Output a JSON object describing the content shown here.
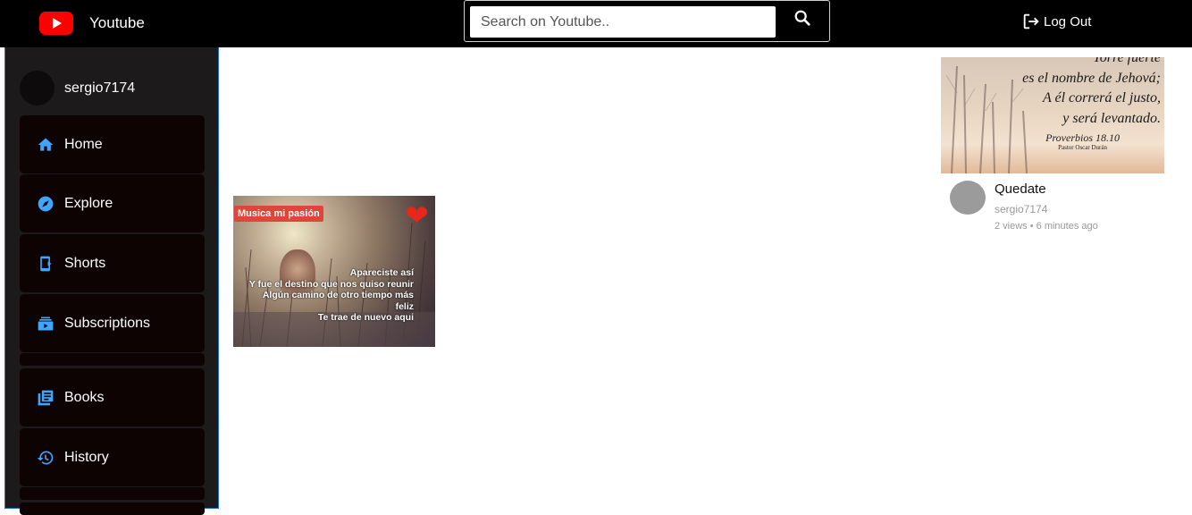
{
  "header": {
    "brand": "Youtube",
    "search": {
      "placeholder": "Search on Youtube..",
      "value": ""
    },
    "logout_label": "Log Out"
  },
  "sidebar": {
    "username": "sergio7174",
    "items": [
      {
        "label": "Home",
        "icon": "home-icon"
      },
      {
        "label": "Explore",
        "icon": "compass-icon"
      },
      {
        "label": "Shorts",
        "icon": "shorts-icon"
      },
      {
        "label": "Subscriptions",
        "icon": "subscriptions-icon"
      },
      {
        "label": "Books",
        "icon": "library-icon"
      },
      {
        "label": "History",
        "icon": "history-icon"
      }
    ]
  },
  "videos": [
    {
      "title": "Quedate",
      "channel": "sergio7174",
      "stats": "2 views • 6 minutes ago",
      "thumbnail_text": {
        "lines": [
          "Torre fuerte",
          "es el nombre de Jehová;",
          "A él correrá el justo,",
          "y será levantado."
        ],
        "reference": "Proverbios 18.10",
        "author": "Pastor Oscar Durán"
      }
    },
    {
      "thumbnail_text": {
        "badge": "Musica mi pasión",
        "lines": [
          "Apareciste así",
          "Y fue el destino que nos quiso reunir",
          "Algún camino de otro tiempo más",
          "feliz",
          "Te trae de nuevo aqui"
        ]
      }
    }
  ],
  "colors": {
    "topbar": "#000000",
    "sidebar": "#1c1a1b",
    "menu_item": "#0e0303",
    "icon_accent": "#3ea6ff",
    "logo_red": "#ff0000"
  }
}
